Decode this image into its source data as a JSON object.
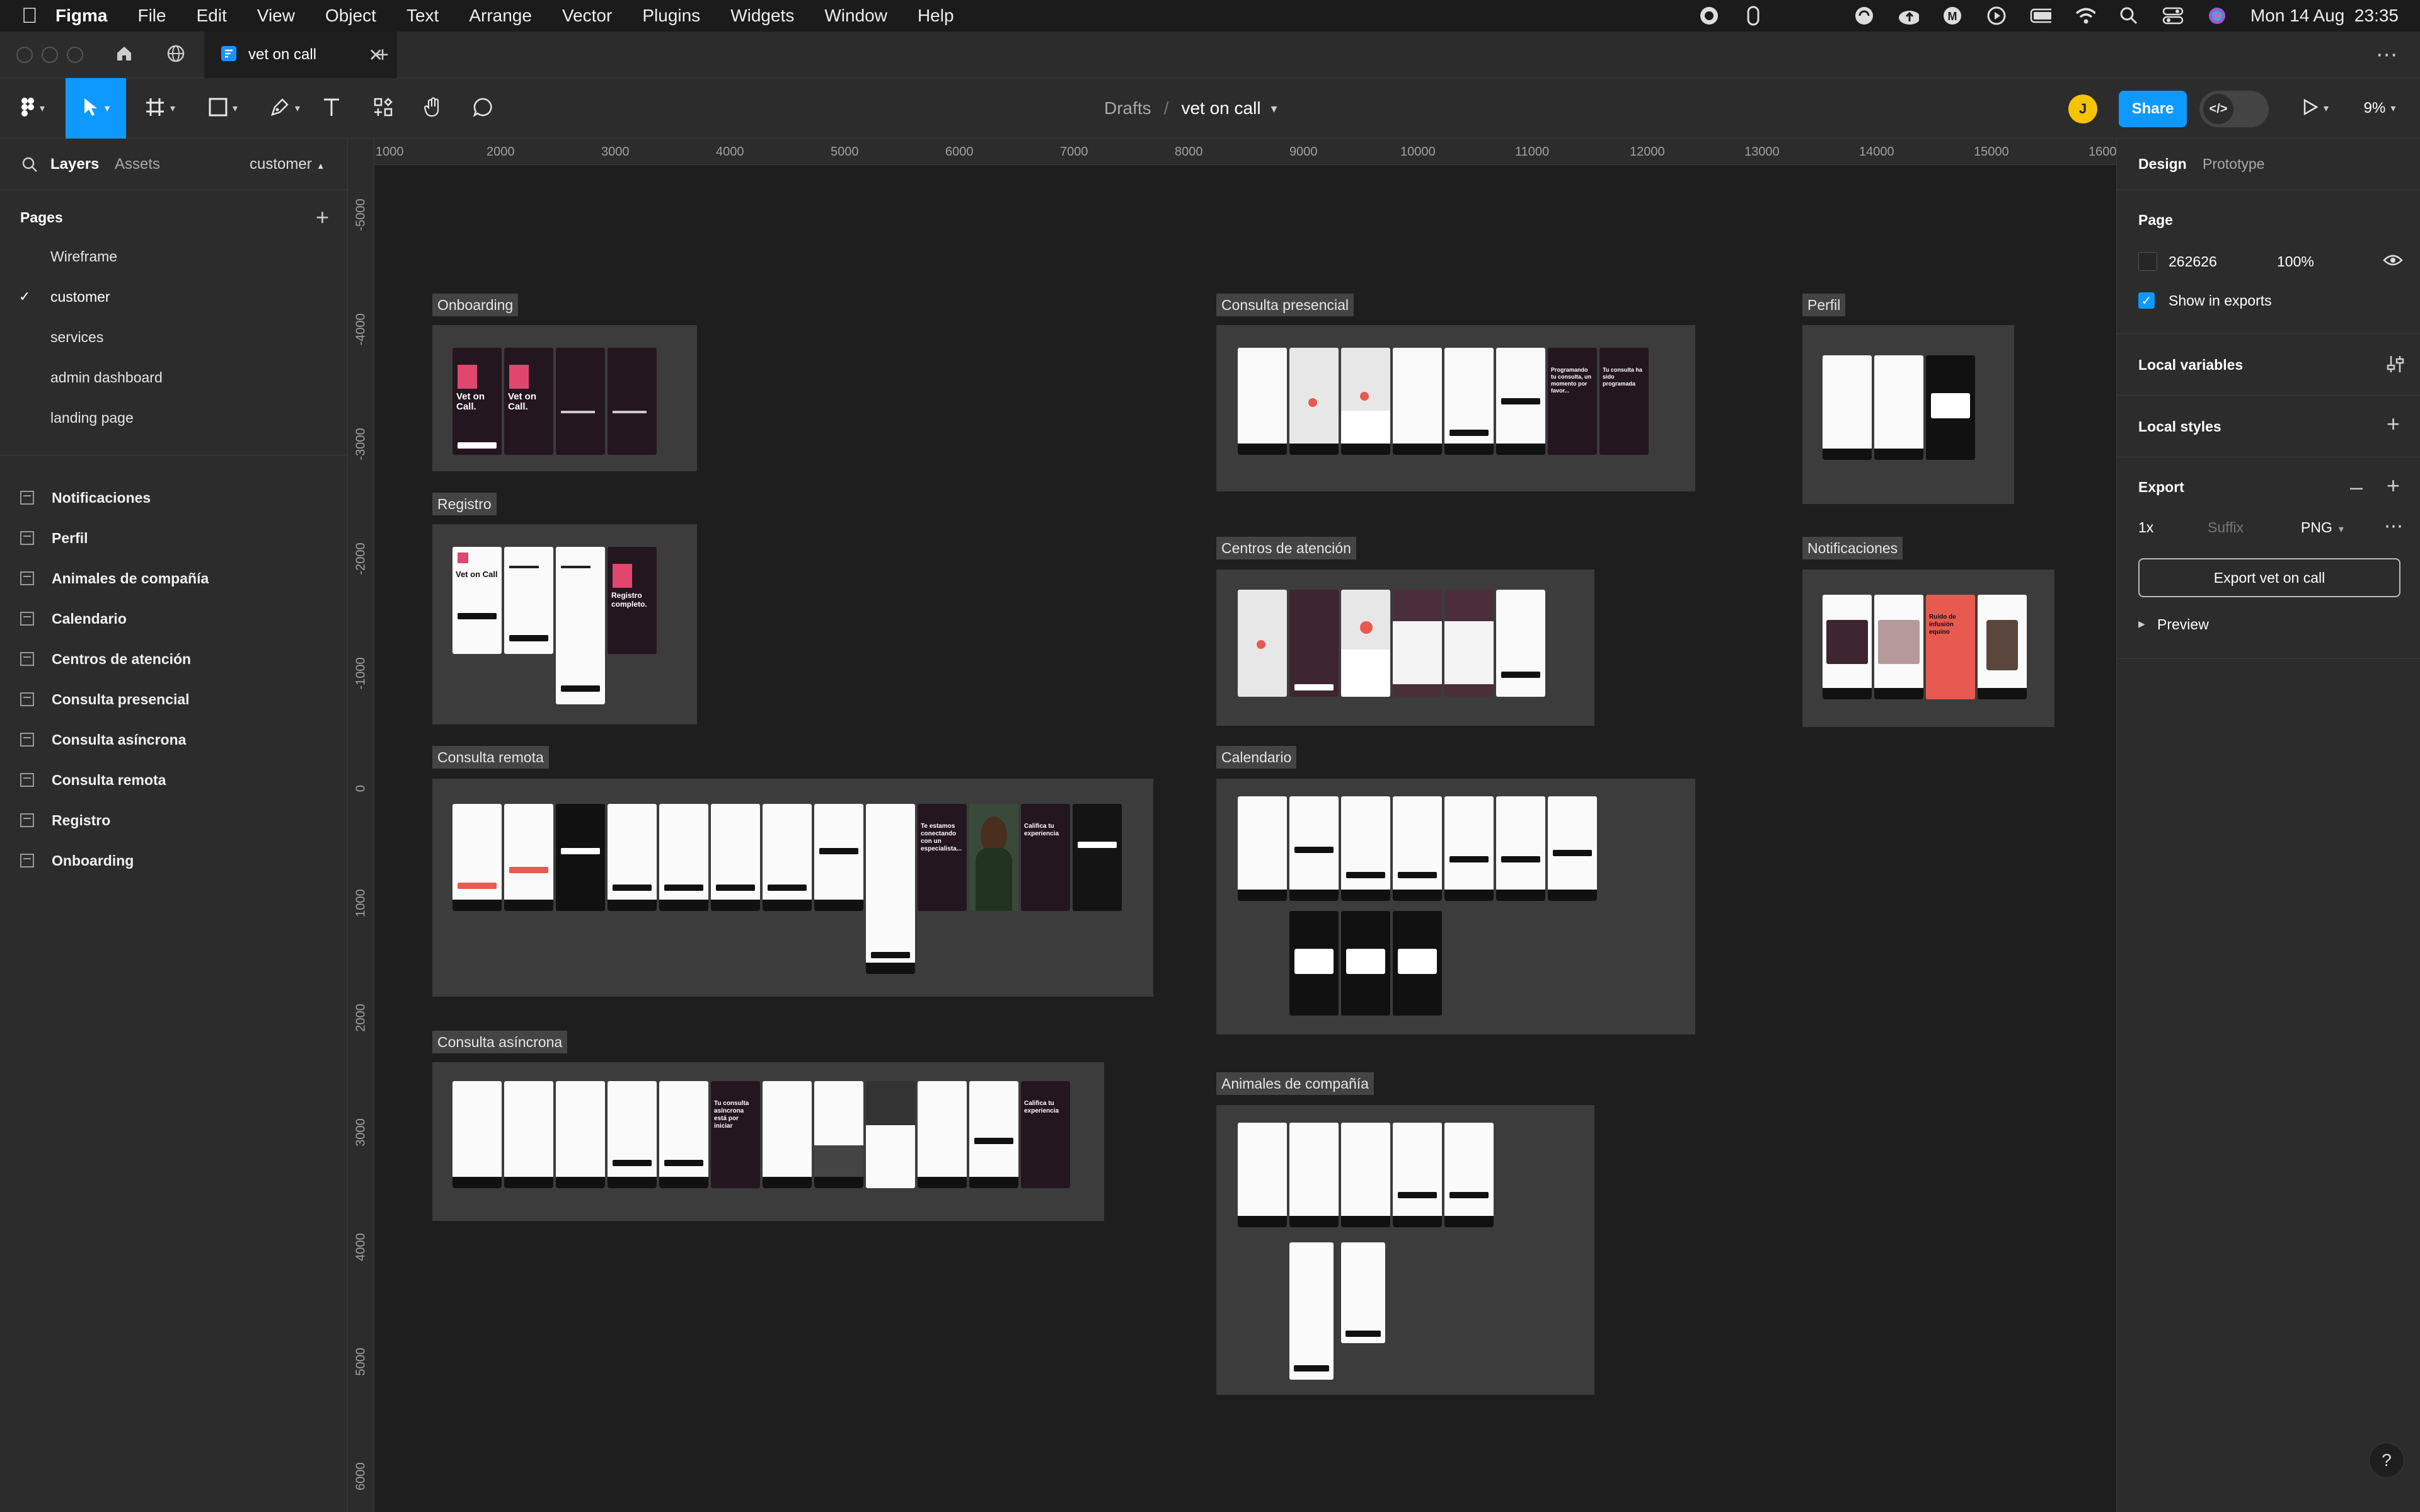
{
  "menubar": {
    "app_name": "Figma",
    "items": [
      "File",
      "Edit",
      "View",
      "Object",
      "Text",
      "Arrange",
      "Vector",
      "Plugins",
      "Widgets",
      "Window",
      "Help"
    ],
    "clock": "Mon 14 Aug  23:35"
  },
  "tabs": {
    "file_tab_label": "vet on call",
    "new_tab": "+",
    "more": "⋯"
  },
  "toolbar": {
    "breadcrumb_root": "Drafts",
    "breadcrumb_sep": "/",
    "file_name": "vet on call",
    "avatar_initial": "J",
    "share_label": "Share",
    "zoom": "9%"
  },
  "left_panel": {
    "tab_layers": "Layers",
    "tab_assets": "Assets",
    "page_selector": "customer",
    "pages_heading": "Pages",
    "pages": [
      {
        "name": "Wireframe",
        "selected": false
      },
      {
        "name": "customer",
        "selected": true
      },
      {
        "name": "services",
        "selected": false
      },
      {
        "name": "admin dashboard",
        "selected": false
      },
      {
        "name": "landing page",
        "selected": false
      }
    ],
    "layers": [
      "Notificaciones",
      "Perfil",
      "Animales de compañía",
      "Calendario",
      "Centros de atención",
      "Consulta presencial",
      "Consulta asíncrona",
      "Consulta remota",
      "Registro",
      "Onboarding"
    ]
  },
  "rulers": {
    "top": [
      "1000",
      "2000",
      "3000",
      "4000",
      "5000",
      "6000",
      "7000",
      "8000",
      "9000",
      "10000",
      "11000",
      "12000",
      "13000",
      "14000",
      "15000",
      "1600"
    ],
    "left": [
      "-5000",
      "-4000",
      "-3000",
      "-2000",
      "-1000",
      "0",
      "1000",
      "2000",
      "3000",
      "4000",
      "5000",
      "6000"
    ]
  },
  "canvas": {
    "sections": [
      {
        "label": "Onboarding"
      },
      {
        "label": "Registro"
      },
      {
        "label": "Consulta remota"
      },
      {
        "label": "Consulta asíncrona"
      },
      {
        "label": "Consulta presencial"
      },
      {
        "label": "Centros de atención"
      },
      {
        "label": "Calendario"
      },
      {
        "label": "Animales de compañía"
      },
      {
        "label": "Perfil"
      },
      {
        "label": "Notificaciones"
      }
    ],
    "screen_texts": {
      "onboarding_1": "Vet on Call.",
      "onboarding_2": "Vet on Call.",
      "registro_1": "Vet on Call",
      "registro_2": "Registro completo.",
      "remota_1": "Te estamos conectando con un especialista...",
      "remota_2": "Califica tu experiencia",
      "asincrona_1": "Tu consulta asíncrona está por iniciar",
      "asincrona_2": "Califica tu experiencia",
      "presencial_1": "Programando tu consulta, un momento por favor...",
      "presencial_2": "Tu consulta ha sido programada",
      "notificaciones_1": "Ruido de infusión equino"
    }
  },
  "right_panel": {
    "tab_design": "Design",
    "tab_prototype": "Prototype",
    "page_heading": "Page",
    "page_color": "262626",
    "page_opacity": "100%",
    "show_in_exports": "Show in exports",
    "show_in_exports_checked": true,
    "local_variables": "Local variables",
    "local_styles": "Local styles",
    "export_heading": "Export",
    "export_scale": "1x",
    "export_suffix_placeholder": "Suffix",
    "export_format": "PNG",
    "export_button": "Export vet on call",
    "preview": "Preview",
    "help": "?"
  },
  "colors": {
    "accent": "#0d99ff",
    "canvas_bg": "#1e1e1e",
    "section_bg": "#3c3c3c",
    "avatar": "#f5c400",
    "brand_pink": "#e0466e",
    "brand_red": "#e85a4f"
  }
}
